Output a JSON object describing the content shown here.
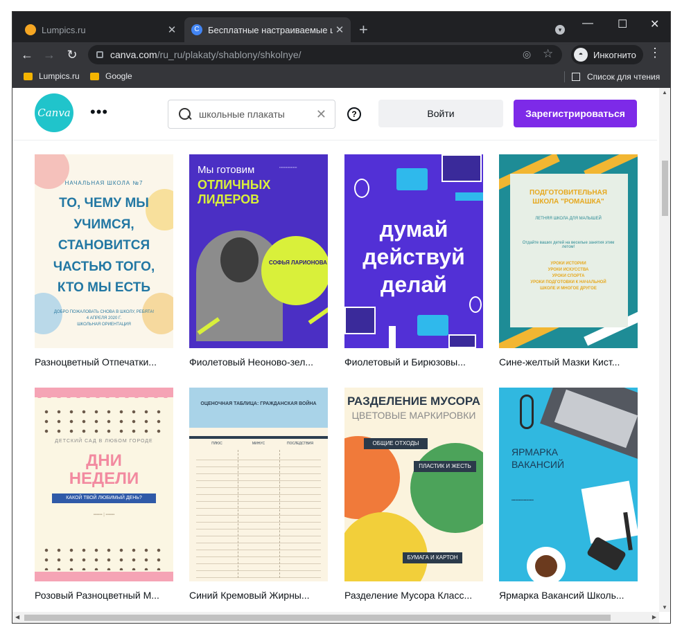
{
  "browser": {
    "tabs": [
      {
        "title": "Lumpics.ru",
        "favicon_color": "#f5a623"
      },
      {
        "title": "Бесплатные настраиваемые ша",
        "favicon_color": "#4285f4"
      }
    ],
    "address": {
      "domain": "canva.com",
      "path": "/ru_ru/plakaty/shablony/shkolnye/"
    },
    "incognito_label": "Инкогнито",
    "bookmarks": [
      "Lumpics.ru",
      "Google"
    ],
    "reading_list": "Список для чтения"
  },
  "canva": {
    "logo_text": "Canva",
    "search_value": "школьные плакаты",
    "login_label": "Войти",
    "signup_label": "Зарегистрироваться",
    "brand_color": "#7d2ae8"
  },
  "templates": [
    {
      "caption": "Разноцветный Отпечатки...",
      "lines": [
        "НАЧАЛЬНАЯ ШКОЛА №7",
        "ТО, ЧЕМУ МЫ",
        "УЧИМСЯ,",
        "СТАНОВИТСЯ",
        "ЧАСТЬЮ ТОГО,",
        "КТО МЫ ЕСТЬ",
        "ДОБРО ПОЖАЛОВАТЬ СНОВА В ШКОЛУ, РЕБЯТА!",
        "4 АПРЕЛЯ 2020 Г.",
        "ШКОЛЬНАЯ ОРИЕНТАЦИЯ"
      ]
    },
    {
      "caption": "Фиолетовый Неоново-зел...",
      "lines": [
        "Мы готовим",
        "ОТЛИЧНЫХ",
        "ЛИДЕРОВ",
        "СОФЬЯ ЛАРИОНОВА"
      ]
    },
    {
      "caption": "Фиолетовый и Бирюзовы...",
      "lines": [
        "думай",
        "действуй",
        "делай"
      ]
    },
    {
      "caption": "Сине-желтый Мазки Кист...",
      "lines": [
        "ПОДГОТОВИТЕЛЬНАЯ",
        "ШКОЛА \"РОМАШКА\"",
        "ЛЕТНЯЯ ШКОЛА ДЛЯ МАЛЫШЕЙ",
        "Отдайте ваших детей на веселые занятия этим летом!",
        "УРОКИ ИСТОРИИ",
        "УРОКИ ИСКУССТВА",
        "УРОКИ СПОРТА",
        "УРОКИ ПОДГОТОВКИ К НАЧАЛЬНОЙ",
        "ШКОЛЕ И МНОГОЕ ДРУГОЕ"
      ]
    },
    {
      "caption": "Розовый Разноцветный М...",
      "lines": [
        "ДЕТСКИЙ САД В ЛЮБОМ ГОРОДЕ",
        "ДНИ",
        "НЕДЕЛИ",
        "КАКОЙ ТВОЙ ЛЮБИМЫЙ ДЕНЬ?"
      ]
    },
    {
      "caption": "Синий Кремовый Жирны...",
      "lines": [
        "ОЦЕНОЧНАЯ ТАБЛИЦА: ГРАЖДАНСКАЯ ВОЙНА",
        "ПЛЮС",
        "МИНУС",
        "ПОСЛЕДСТВИЯ"
      ]
    },
    {
      "caption": "Разделение Мусора Класс...",
      "lines": [
        "РАЗДЕЛЕНИЕ МУСОРА",
        "ЦВЕТОВЫЕ МАРКИРОВКИ",
        "ОБЩИЕ ОТХОДЫ",
        "ПЛАСТИК И ЖЕСТЬ",
        "БУМАГА И КАРТОН"
      ]
    },
    {
      "caption": "Ярмарка Вакансий Школь...",
      "lines": [
        "ЯРМАРКА",
        "ВАКАНСИЙ"
      ]
    }
  ]
}
